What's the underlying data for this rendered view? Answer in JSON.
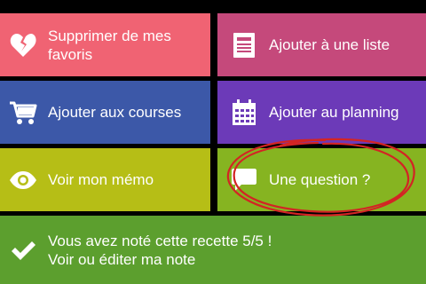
{
  "tiles": {
    "remove_favorites": {
      "label_line1": "Supprimer de mes",
      "label_line2": "favoris",
      "icon": "broken-heart-icon",
      "color": "#f06373"
    },
    "add_to_list": {
      "label": "Ajouter à une liste",
      "icon": "list-icon",
      "color": "#c5497b"
    },
    "add_to_shopping": {
      "label": "Ajouter aux courses",
      "icon": "cart-icon",
      "color": "#3c58a8"
    },
    "add_to_planning": {
      "label": "Ajouter au planning",
      "icon": "calendar-icon",
      "color": "#6c3ab8"
    },
    "memo": {
      "label": "Voir mon mémo",
      "icon": "eye-icon",
      "color": "#b6be16"
    },
    "question": {
      "label": "Une question ?",
      "icon": "speech-bubble-icon",
      "color": "#86b421"
    },
    "rating": {
      "label_line1": "Vous avez noté cette recette 5/5 !",
      "label_line2": "Voir ou éditer ma note",
      "icon": "checkmark-icon",
      "color": "#5c9f2e"
    }
  },
  "annotation": {
    "color": "#d32424"
  }
}
